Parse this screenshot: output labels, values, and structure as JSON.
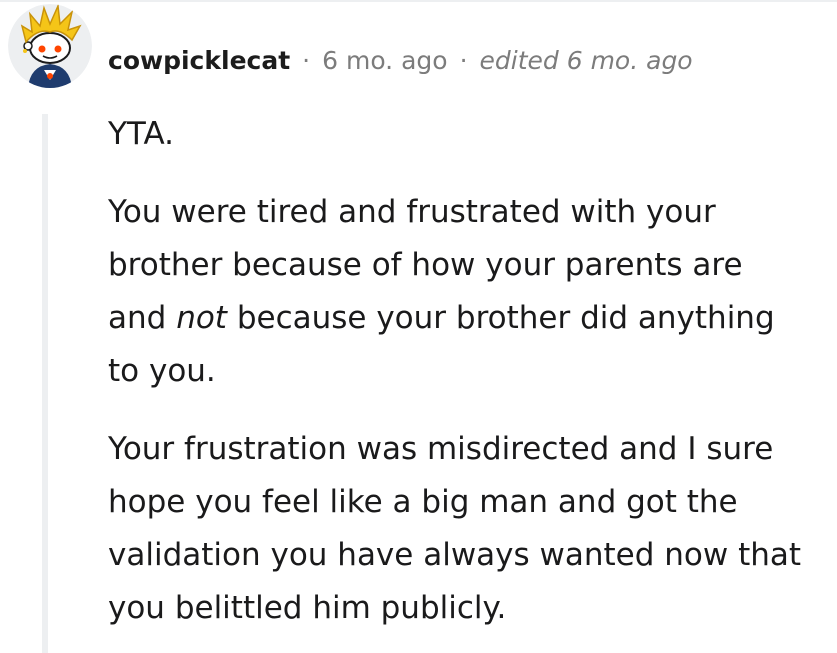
{
  "comment": {
    "author": "cowpicklecat",
    "separator": "·",
    "age": "6 mo. ago",
    "edited": "edited 6 mo. ago",
    "avatar_icon": "reddit-snoo-avatar-icon",
    "paragraphs": {
      "p1": "YTA.",
      "p2_before": "You were tired and frustrated with your brother because of how your parents are and ",
      "p2_em": "not",
      "p2_after": " because your brother did anything to you.",
      "p3": "Your frustration was misdirected and I sure hope you feel like a big man and got the validation you have always wanted now that you belittled him publicly."
    }
  },
  "colors": {
    "text": "#1a1a1b",
    "meta": "#7c7c7c",
    "thread_line": "#edeff1",
    "avatar_bg": "#edeff1",
    "hair": "#f5c518",
    "shirt": "#1f3c6e",
    "accent": "#ff4500"
  }
}
